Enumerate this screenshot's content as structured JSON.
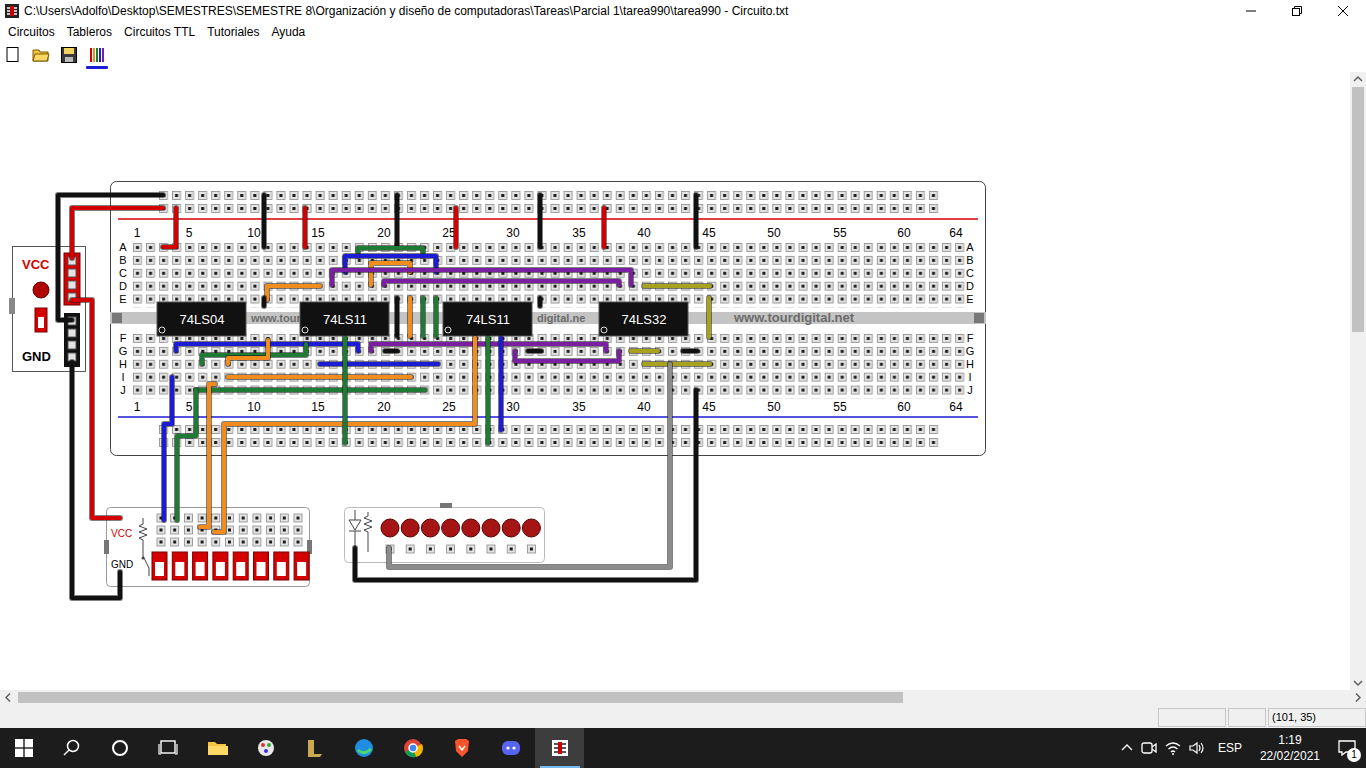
{
  "window": {
    "title": "C:\\Users\\Adolfo\\Desktop\\SEMESTRES\\SEMESTRE 8\\Organización y diseño de computadoras\\Tareas\\Parcial 1\\tarea990\\tarea990 - Circuito.txt"
  },
  "menu": [
    "Circuitos",
    "Tableros",
    "Circuitos TTL",
    "Tutoriales",
    "Ayuda"
  ],
  "toolbar": [
    {
      "selected": false
    },
    {
      "selected": false
    },
    {
      "selected": false
    },
    {
      "selected": true
    }
  ],
  "breadboard": {
    "columns": [
      "1",
      "5",
      "10",
      "15",
      "20",
      "25",
      "30",
      "35",
      "40",
      "45",
      "50",
      "55",
      "60",
      "64"
    ],
    "rows_top": [
      "A",
      "B",
      "C",
      "D",
      "E"
    ],
    "rows_bottom": [
      "F",
      "G",
      "H",
      "I",
      "J"
    ],
    "watermark": [
      "www.tour",
      "digital.ne",
      "www.tourdigital.net"
    ]
  },
  "chips": [
    {
      "label": "74LS04"
    },
    {
      "label": "74LS11"
    },
    {
      "label": "74LS11"
    },
    {
      "label": "74LS32"
    }
  ],
  "power_supply": {
    "vcc": "VCC",
    "gnd": "GND"
  },
  "switches": {
    "vcc": "VCC",
    "gnd": "GND",
    "items": [
      {
        "on": false
      },
      {
        "on": false
      },
      {
        "on": false
      },
      {
        "on": false
      },
      {
        "on": false
      },
      {
        "on": false
      },
      {
        "on": false
      },
      {
        "on": false
      }
    ]
  },
  "leds": [
    {
      "on": false
    },
    {
      "on": false
    },
    {
      "on": false
    },
    {
      "on": false
    },
    {
      "on": false
    },
    {
      "on": false
    },
    {
      "on": false
    },
    {
      "on": false
    }
  ],
  "wires": [
    {
      "color": "#111111"
    },
    {
      "color": "#d40000"
    },
    {
      "color": "#d40000"
    },
    {
      "color": "#111111"
    },
    {
      "color": "#d40000"
    },
    {
      "color": "#d40000"
    },
    {
      "color": "#d40000"
    },
    {
      "color": "#d40000"
    },
    {
      "color": "#111111"
    },
    {
      "color": "#111111"
    },
    {
      "color": "#111111"
    },
    {
      "color": "#111111"
    },
    {
      "color": "#1e7b34"
    },
    {
      "color": "#1c1cd6"
    },
    {
      "color": "#f28c1c"
    },
    {
      "color": "#7b1fa2"
    },
    {
      "color": "#7b1fa2"
    },
    {
      "color": "#f28c1c"
    },
    {
      "color": "#a9a21e"
    },
    {
      "color": "#111111"
    },
    {
      "color": "#111111"
    },
    {
      "color": "#f28c1c"
    },
    {
      "color": "#1e7b34"
    },
    {
      "color": "#1e7b34"
    },
    {
      "color": "#111111"
    },
    {
      "color": "#a9a21e"
    },
    {
      "color": "#1c1cd6"
    },
    {
      "color": "#1e7b34"
    },
    {
      "color": "#f28c1c"
    },
    {
      "color": "#7b1fa2"
    },
    {
      "color": "#7b1fa2"
    },
    {
      "color": "#1c1cd6"
    },
    {
      "color": "#f28c1c"
    },
    {
      "color": "#1e7b34"
    },
    {
      "color": "#1c1cd6"
    },
    {
      "color": "#1e7b34"
    },
    {
      "color": "#f28c1c"
    },
    {
      "color": "#f28c1c"
    },
    {
      "color": "#1e7b34"
    },
    {
      "color": "#1e7b34"
    },
    {
      "color": "#1c1cd6"
    },
    {
      "color": "#a9a21e"
    },
    {
      "color": "#a9a21e"
    },
    {
      "color": "#111111"
    },
    {
      "color": "#111111"
    },
    {
      "color": "#111111"
    },
    {
      "color": "#111111"
    },
    {
      "color": "#8c8c8c"
    }
  ],
  "status_bar": {
    "coords": "(101, 35)"
  },
  "taskbar": {
    "apps": [
      {
        "active": false
      },
      {
        "active": false
      },
      {
        "active": false
      },
      {
        "active": false
      },
      {
        "active": false
      },
      {
        "active": false
      },
      {
        "active": false
      },
      {
        "active": true
      }
    ],
    "language": "ESP",
    "time": "1:19",
    "date": "22/02/2021",
    "notifications": "1"
  }
}
